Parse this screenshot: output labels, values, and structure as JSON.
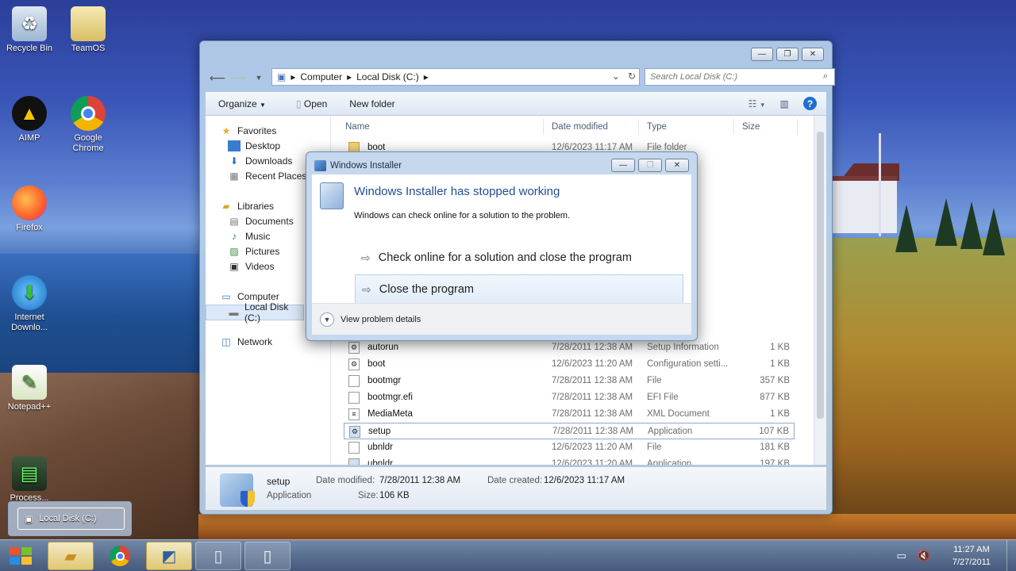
{
  "desktop": {
    "icons": [
      {
        "label": "Recycle Bin"
      },
      {
        "label": "TeamOS"
      },
      {
        "label": "AIMP"
      },
      {
        "label": "Google Chrome"
      },
      {
        "label": "Firefox"
      },
      {
        "label": "Internet Downlo..."
      },
      {
        "label": "Notepad++"
      },
      {
        "label": "Process..."
      }
    ]
  },
  "explorer": {
    "address": {
      "seg1": "Computer",
      "seg2": "Local Disk (C:)"
    },
    "search_placeholder": "Search Local Disk (C:)",
    "toolbar": {
      "organize": "Organize",
      "open": "Open",
      "new_folder": "New folder"
    },
    "nav": {
      "favorites": "Favorites",
      "desktop": "Desktop",
      "downloads": "Downloads",
      "recent": "Recent Places",
      "libraries": "Libraries",
      "documents": "Documents",
      "music": "Music",
      "pictures": "Pictures",
      "videos": "Videos",
      "computer": "Computer",
      "local_disk": "Local Disk (C:)",
      "network": "Network"
    },
    "columns": {
      "name": "Name",
      "date": "Date modified",
      "type": "Type",
      "size": "Size"
    },
    "rows": [
      {
        "name": "boot",
        "date": "12/6/2023 11:17 AM",
        "type": "File folder",
        "size": ""
      },
      {
        "name": "autorun",
        "date": "7/28/2011 12:38 AM",
        "type": "Setup Information",
        "size": "1 KB"
      },
      {
        "name": "boot",
        "date": "12/6/2023 11:20 AM",
        "type": "Configuration setti...",
        "size": "1 KB"
      },
      {
        "name": "bootmgr",
        "date": "7/28/2011 12:38 AM",
        "type": "File",
        "size": "357 KB"
      },
      {
        "name": "bootmgr.efi",
        "date": "7/28/2011 12:38 AM",
        "type": "EFI File",
        "size": "877 KB"
      },
      {
        "name": "MediaMeta",
        "date": "7/28/2011 12:38 AM",
        "type": "XML Document",
        "size": "1 KB"
      },
      {
        "name": "setup",
        "date": "7/28/2011 12:38 AM",
        "type": "Application",
        "size": "107 KB"
      },
      {
        "name": "ubnldr",
        "date": "12/6/2023 11:20 AM",
        "type": "File",
        "size": "181 KB"
      },
      {
        "name": "ubnldr",
        "date": "12/6/2023 11:20 AM",
        "type": "Application",
        "size": "197 KB"
      }
    ],
    "details": {
      "name": "setup",
      "kind": "Application",
      "modified_label": "Date modified:",
      "modified_value": "7/28/2011 12:38 AM",
      "created_label": "Date created:",
      "created_value": "12/6/2023 11:17 AM",
      "size_label": "Size:",
      "size_value": "106 KB"
    }
  },
  "dialog": {
    "title": "Windows Installer",
    "heading": "Windows Installer has stopped working",
    "text": "Windows can check online for a solution to the problem.",
    "option1": "Check online for a solution and close the program",
    "option2": "Close the program",
    "details": "View problem details"
  },
  "taskbar": {
    "preview_label": "Local Disk (C:)",
    "time": "11:27 AM",
    "date": "7/27/2011"
  }
}
